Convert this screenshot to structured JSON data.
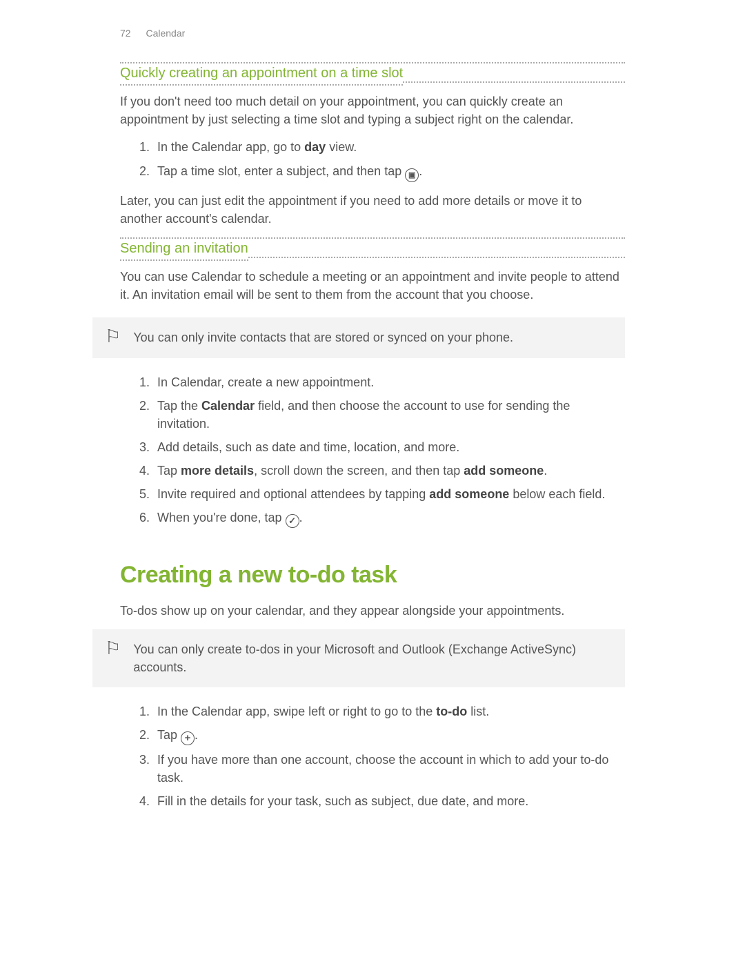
{
  "header": {
    "page_number": "72",
    "chapter": "Calendar"
  },
  "section1": {
    "title": "Quickly creating an appointment on a time slot",
    "intro": "If you don't need too much detail on your appointment, you can quickly create an appointment by just selecting a time slot and typing a subject right on the calendar.",
    "steps": {
      "s1a": "In the Calendar app, go to ",
      "s1b": "day",
      "s1c": " view.",
      "s2a": "Tap a time slot, enter a subject, and then tap ",
      "s2b": "."
    },
    "outro": "Later, you can just edit the appointment if you need to add more details or move it to another account's calendar."
  },
  "section2": {
    "title": "Sending an invitation",
    "intro": "You can use Calendar to schedule a meeting or an appointment and invite people to attend it. An invitation email will be sent to them from the account that you choose.",
    "note": "You can only invite contacts that are stored or synced on your phone.",
    "steps": {
      "s1": "In Calendar, create a new appointment.",
      "s2a": "Tap the ",
      "s2b": "Calendar",
      "s2c": " field, and then choose the account to use for sending the invitation.",
      "s3": "Add details, such as date and time, location, and more.",
      "s4a": "Tap ",
      "s4b": "more details",
      "s4c": ", scroll down the screen, and then tap ",
      "s4d": "add someone",
      "s4e": ".",
      "s5a": "Invite required and optional attendees by tapping ",
      "s5b": "add someone",
      "s5c": " below each field.",
      "s6a": "When you're done, tap ",
      "s6b": "."
    }
  },
  "section3": {
    "title": "Creating a new to-do task",
    "intro": "To-dos show up on your calendar, and they appear alongside your appointments.",
    "note": "You can only create to-dos in your Microsoft and Outlook (Exchange ActiveSync) accounts.",
    "steps": {
      "s1a": "In the Calendar app, swipe left or right to go to the ",
      "s1b": "to-do",
      "s1c": " list.",
      "s2a": "Tap ",
      "s2b": ".",
      "s3": "If you have more than one account, choose the account in which to add your to-do task.",
      "s4": "Fill in the details for your task, such as subject, due date, and more."
    }
  }
}
